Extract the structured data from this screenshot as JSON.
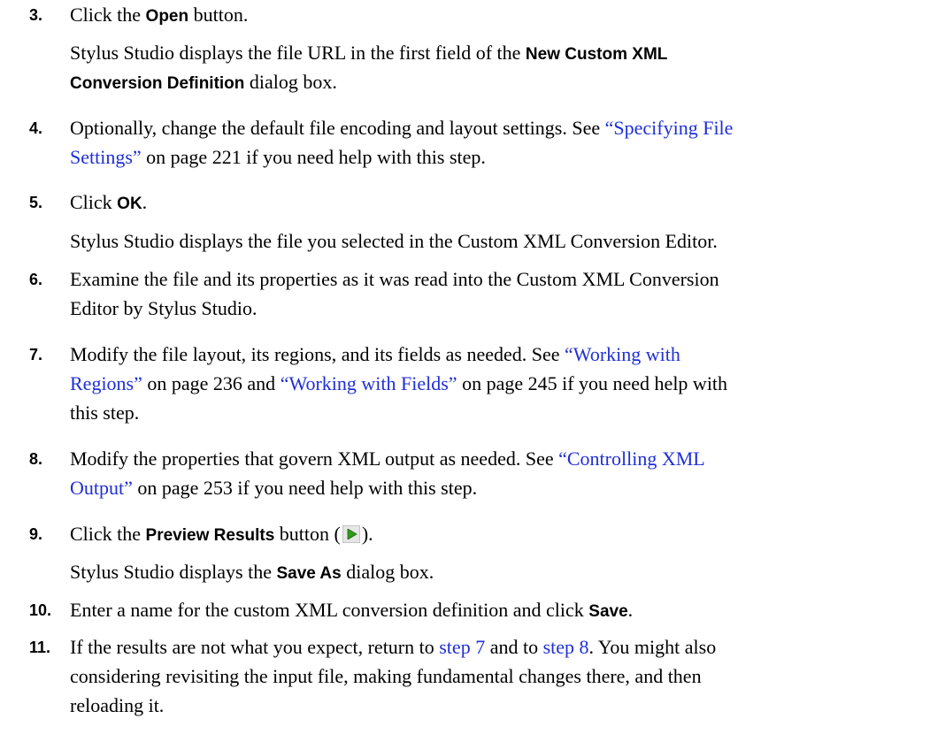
{
  "steps": [
    {
      "num": "3.",
      "a": "Click the ",
      "b": "Open",
      "c": " button."
    },
    {
      "num": "",
      "l1a": "Stylus Studio displays the file URL in the first field of the ",
      "l1b": "New Custom XML",
      "l2b": "Conversion Definition",
      "l2c": " dialog box."
    },
    {
      "num": "4.",
      "l1a": "Optionally, change the default file encoding and layout settings. See ",
      "l1link": "“Specifying File",
      "l2link": "Settings”",
      "l2c": " on page 221 if you need help with this step."
    },
    {
      "num": "5.",
      "a": "Click ",
      "b": "OK",
      "c": "."
    },
    {
      "num": "",
      "text": "Stylus Studio displays the file you selected in the Custom XML Conversion Editor."
    },
    {
      "num": "6.",
      "l1": "Examine the file and its properties as it was read into the Custom XML Conversion",
      "l2": "Editor by Stylus Studio."
    },
    {
      "num": "7.",
      "l1a": "Modify the file layout, its regions, and its fields as needed. See ",
      "l1link": "“Working with",
      "l2link": "Regions”",
      "l2b": " on page 236 and ",
      "l2link2": "“Working with Fields”",
      "l2c": " on page 245 if you need help with",
      "l3": "this step."
    },
    {
      "num": "8.",
      "l1a": "Modify the properties that govern XML output as needed. See ",
      "l1link": "“Controlling XML",
      "l2link": "Output”",
      "l2c": " on page 253 if you need help with this step."
    },
    {
      "num": "9.",
      "a": "Click the ",
      "b": "Preview Results",
      "c": " button (",
      "d": ")."
    },
    {
      "num": "",
      "a": "Stylus Studio displays the ",
      "b": "Save As",
      "c": " dialog box."
    },
    {
      "num": "10.",
      "a": "Enter a name for the custom XML conversion definition and click ",
      "b": "Save",
      "c": "."
    },
    {
      "num": "11.",
      "l1a": "If the results are not what you expect, return to ",
      "l1link": "step 7",
      "l1b": " and to ",
      "l1link2": "step 8",
      "l1c": ". You might also",
      "l2": "considering revisiting the input file, making fundamental changes there, and then",
      "l3": "reloading it."
    }
  ],
  "icons": {
    "preview": "play-triangle-icon",
    "preview_color": "#2e9a1c"
  },
  "colors": {
    "link": "#1f2fd6"
  }
}
